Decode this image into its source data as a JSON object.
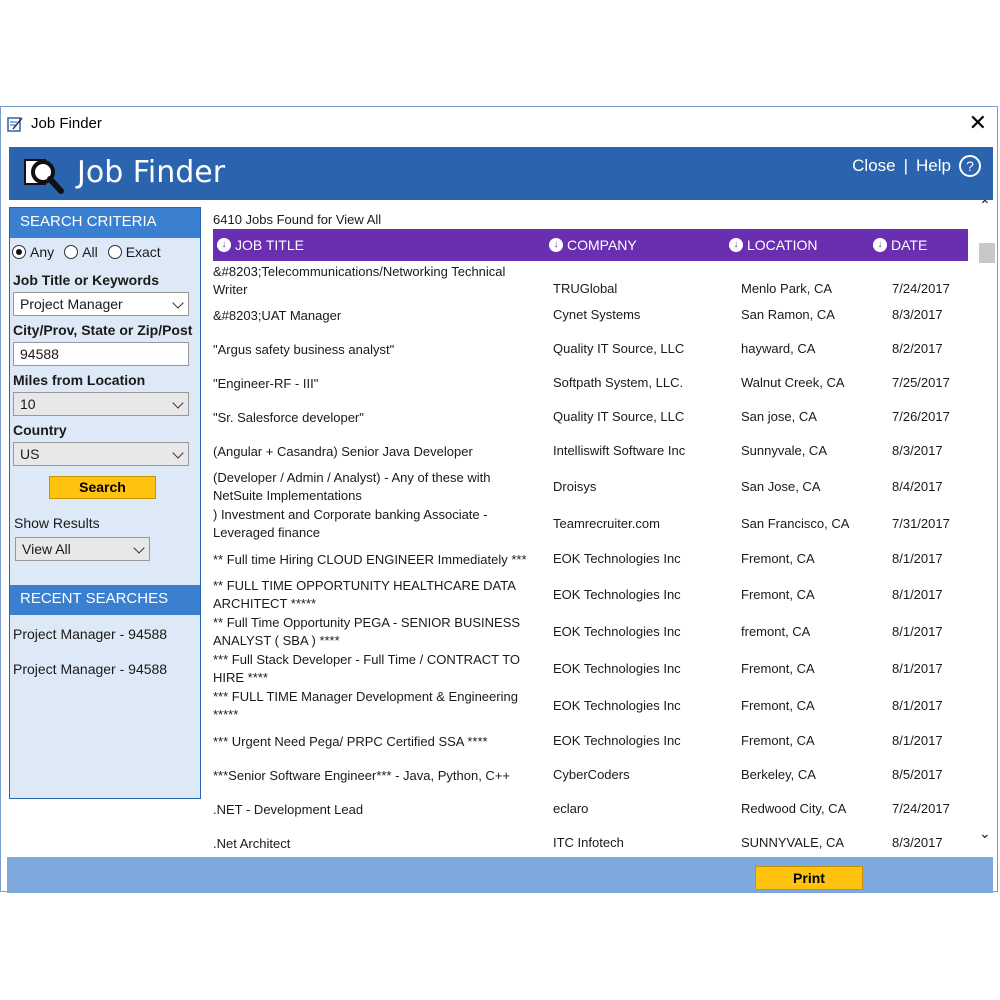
{
  "window": {
    "title": "Job Finder",
    "close_glyph": "✕"
  },
  "banner": {
    "title": "Job Finder",
    "close_label": "Close",
    "separator": "|",
    "help_label": "Help",
    "help_glyph": "?"
  },
  "sidebar": {
    "criteria_header": "SEARCH CRITERIA",
    "radios": [
      {
        "label": "Any",
        "checked": true
      },
      {
        "label": "All",
        "checked": false
      },
      {
        "label": "Exact",
        "checked": false
      }
    ],
    "keyword_label": "Job Title or Keywords",
    "keyword_value": "Project Manager",
    "location_label": "City/Prov, State or Zip/Post",
    "location_value": "94588",
    "miles_label": "Miles from Location",
    "miles_value": "10",
    "country_label": "Country",
    "country_value": "US",
    "search_button": "Search",
    "show_results_label": "Show Results",
    "show_results_value": "View All",
    "recent_header": "RECENT SEARCHES",
    "recent": [
      "Project Manager - 94588",
      "Project Manager - 94588"
    ]
  },
  "results": {
    "count_text": "6410 Jobs Found for View All",
    "columns": [
      "JOB TITLE",
      "COMPANY",
      "LOCATION",
      "DATE"
    ],
    "rows": [
      {
        "title": "&#8203;Telecommunications/Networking Technical Writer",
        "company": "TRUGlobal",
        "location": "Menlo Park, CA",
        "date": "7/24/2017"
      },
      {
        "title": "&#8203;UAT Manager",
        "company": "Cynet Systems",
        "location": "San Ramon, CA",
        "date": "8/3/2017"
      },
      {
        "title": "\"Argus safety business analyst\"",
        "company": "Quality IT Source, LLC",
        "location": "hayward, CA",
        "date": "8/2/2017"
      },
      {
        "title": "\"Engineer-RF - III\"",
        "company": "Softpath System, LLC.",
        "location": "Walnut Creek, CA",
        "date": "7/25/2017"
      },
      {
        "title": "\"Sr. Salesforce developer\"",
        "company": "Quality IT Source, LLC",
        "location": "San jose, CA",
        "date": "7/26/2017"
      },
      {
        "title": "(Angular + Casandra) Senior Java Developer",
        "company": "Intelliswift Software Inc",
        "location": "Sunnyvale, CA",
        "date": "8/3/2017"
      },
      {
        "title": "(Developer / Admin / Analyst) - Any of these with NetSuite Implementations",
        "company": "Droisys",
        "location": "San Jose, CA",
        "date": "8/4/2017"
      },
      {
        "title": ") Investment and Corporate banking Associate - Leveraged finance",
        "company": "Teamrecruiter.com",
        "location": "San Francisco, CA",
        "date": "7/31/2017"
      },
      {
        "title": "** Full time Hiring CLOUD ENGINEER Immediately ***",
        "company": "EOK Technologies Inc",
        "location": "Fremont, CA",
        "date": "8/1/2017"
      },
      {
        "title": "** FULL TIME OPPORTUNITY HEALTHCARE DATA ARCHITECT *****",
        "company": "EOK Technologies Inc",
        "location": "Fremont, CA",
        "date": "8/1/2017"
      },
      {
        "title": "** Full Time Opportunity PEGA - SENIOR BUSINESS ANALYST ( SBA ) ****",
        "company": "EOK Technologies Inc",
        "location": "fremont, CA",
        "date": "8/1/2017"
      },
      {
        "title": "*** Full Stack Developer - Full Time / CONTRACT TO HIRE ****",
        "company": "EOK Technologies Inc",
        "location": "Fremont, CA",
        "date": "8/1/2017"
      },
      {
        "title": "*** FULL TIME Manager Development & Engineering *****",
        "company": "EOK Technologies Inc",
        "location": "Fremont, CA",
        "date": "8/1/2017"
      },
      {
        "title": "*** Urgent Need Pega/ PRPC Certified SSA ****",
        "company": "EOK Technologies Inc",
        "location": "Fremont, CA",
        "date": "8/1/2017"
      },
      {
        "title": "***Senior Software Engineer*** - Java, Python, C++",
        "company": "CyberCoders",
        "location": "Berkeley, CA",
        "date": "8/5/2017"
      },
      {
        "title": ".NET - Development Lead",
        "company": "eclaro",
        "location": "Redwood City, CA",
        "date": "7/24/2017"
      },
      {
        "title": ".Net Architect",
        "company": "ITC Infotech",
        "location": "SUNNYVALE, CA",
        "date": "8/3/2017"
      }
    ]
  },
  "footer": {
    "print_button": "Print"
  },
  "scroll": {
    "up_glyph": "⌃",
    "down_glyph": "⌄"
  },
  "colors": {
    "banner": "#2a63ae",
    "table_header": "#6a2fb0",
    "button": "#ffc20e",
    "sidebar_bg": "#dde9f6",
    "footer": "#7da9de"
  }
}
